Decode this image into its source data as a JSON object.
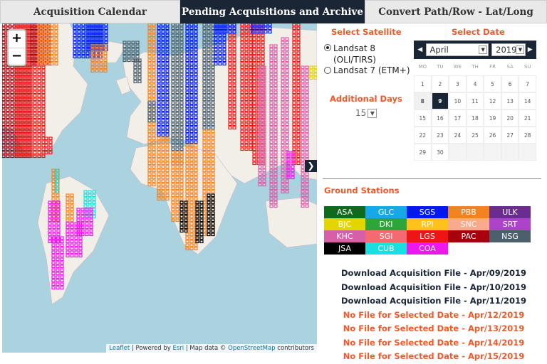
{
  "tabs": [
    {
      "label": "Acquisition Calendar"
    },
    {
      "label": "Pending Acquisitions and Archive"
    },
    {
      "label": "Convert Path/Row - Lat/Long"
    }
  ],
  "map": {
    "zoom_in": "+",
    "zoom_out": "−",
    "attribution": {
      "leaflet": "Leaflet",
      "sep1": " | Powered by ",
      "esri": "Esri",
      "sep2": " | Map data © ",
      "osm": "OpenStreetMap",
      "tail": " contributors"
    },
    "collapse_icon": "chevron-right-icon"
  },
  "satellite": {
    "title": "Select Satellite",
    "options": [
      {
        "label": "Landsat 8 (OLI/TIRS)",
        "selected": true
      },
      {
        "label": "Landsat 7 (ETM+)",
        "selected": false
      }
    ]
  },
  "additional_days": {
    "title": "Additional Days",
    "value": "15"
  },
  "date": {
    "title": "Select Date",
    "month": "April",
    "year": "2019",
    "weekdays": [
      "MO",
      "TU",
      "WE",
      "TH",
      "FR",
      "SA",
      "SU"
    ],
    "days": [
      [
        "1",
        "2",
        "3",
        "4",
        "5",
        "6",
        "7"
      ],
      [
        "8",
        "9",
        "10",
        "11",
        "12",
        "13",
        "14"
      ],
      [
        "15",
        "16",
        "17",
        "18",
        "19",
        "20",
        "21"
      ],
      [
        "22",
        "23",
        "24",
        "25",
        "26",
        "27",
        "28"
      ],
      [
        "29",
        "30",
        "",
        "",
        "",
        "",
        ""
      ]
    ],
    "selected_day": "9",
    "today": "8"
  },
  "stations": {
    "title": "Ground Stations",
    "items": [
      {
        "code": "ASA",
        "color": "#0d6b1e"
      },
      {
        "code": "GLC",
        "color": "#16a8e8"
      },
      {
        "code": "SGS",
        "color": "#0019f2"
      },
      {
        "code": "PBB",
        "color": "#f58220"
      },
      {
        "code": "ULK",
        "color": "#6a2c91"
      },
      {
        "code": "BJC",
        "color": "#e3d600"
      },
      {
        "code": "DKI",
        "color": "#2da53a"
      },
      {
        "code": "RPI",
        "color": "#ffc21a"
      },
      {
        "code": "SNC",
        "color": "#f9a98e"
      },
      {
        "code": "SRT",
        "color": "#ad43c9"
      },
      {
        "code": "KHC",
        "color": "#d65fa8"
      },
      {
        "code": "SGI",
        "color": "#f56a70"
      },
      {
        "code": "LGS",
        "color": "#ef1515"
      },
      {
        "code": "PAC",
        "color": "#a8000c"
      },
      {
        "code": "NSG",
        "color": "#4b5f6d"
      },
      {
        "code": "JSA",
        "color": "#000000"
      },
      {
        "code": "CUB",
        "color": "#18e0e0"
      },
      {
        "code": "COA",
        "color": "#ee18ee"
      }
    ]
  },
  "files": [
    {
      "text": "Download Acquisition File - Apr/09/2019",
      "status": "ok"
    },
    {
      "text": "Download Acquisition File - Apr/10/2019",
      "status": "ok"
    },
    {
      "text": "Download Acquisition File - Apr/11/2019",
      "status": "ok"
    },
    {
      "text": "No File for Selected Date - Apr/12/2019",
      "status": "no"
    },
    {
      "text": "No File for Selected Date - Apr/13/2019",
      "status": "no"
    },
    {
      "text": "No File for Selected Date - Apr/14/2019",
      "status": "no"
    },
    {
      "text": "No File for Selected Date - Apr/15/2019",
      "status": "no"
    }
  ]
}
